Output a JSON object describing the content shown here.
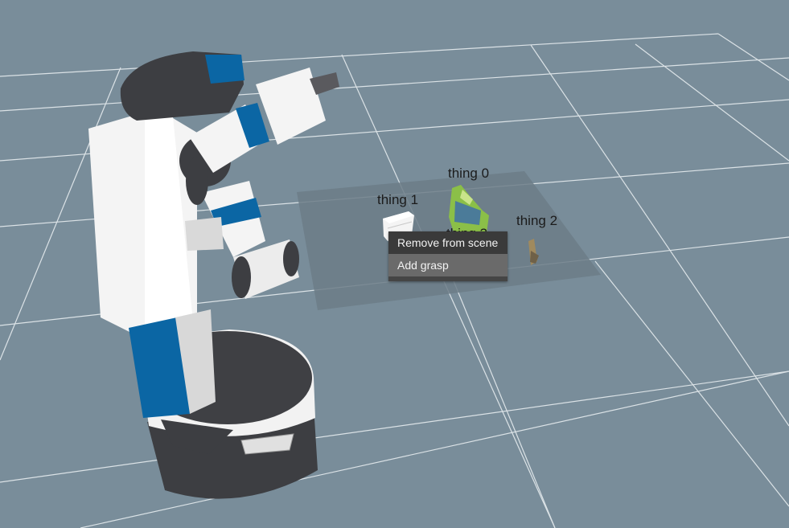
{
  "scene": {
    "background_color": "#798d9a",
    "grid_color": "#e6ecef",
    "table_color": "#6c7d87",
    "objects": [
      {
        "id": "thing-0",
        "label": "thing 0"
      },
      {
        "id": "thing-1",
        "label": "thing 1"
      },
      {
        "id": "thing-2",
        "label": "thing 2"
      },
      {
        "id": "thing-3",
        "label": "thing 3"
      }
    ]
  },
  "robot": {
    "body_color": "#f2f2f2",
    "dark_color": "#3d3e42",
    "accent_color": "#0b66a4"
  },
  "context_menu": {
    "items": [
      {
        "label": "Remove from scene"
      },
      {
        "label": "Add grasp"
      }
    ]
  }
}
